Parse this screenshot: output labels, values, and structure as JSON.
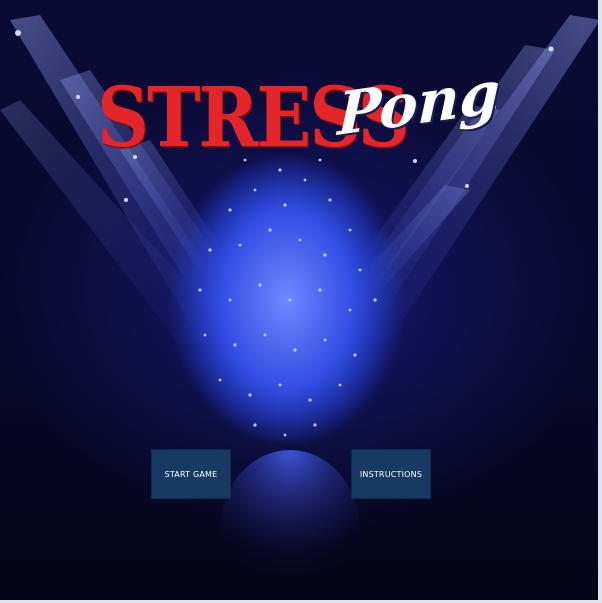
{
  "title": {
    "word1": "STRESS",
    "word2": "Pong"
  },
  "menu": {
    "start_label": "START GAME",
    "instructions_label": "INSTRUCTIONS"
  },
  "colors": {
    "title_red": "#e3262a",
    "title_white": "#ffffff",
    "button_bg": "#173a62",
    "button_text": "#ffffff",
    "background": "#08082a",
    "light_blue": "#3a5cff"
  }
}
